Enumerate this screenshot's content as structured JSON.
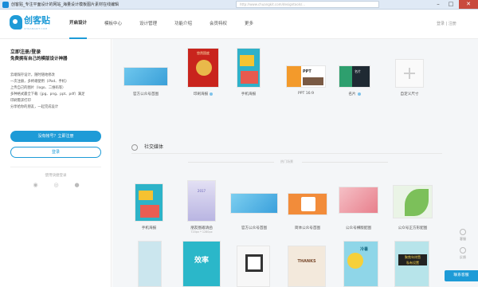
{
  "window": {
    "title": "创客贴_专注平面设计的网站_海量设计模板图片素材在线编辑",
    "url": "http://www.chuangkit.com/designtools/...",
    "controls": {
      "minimize": "–",
      "maximize": "□",
      "close": "✕"
    }
  },
  "brand": {
    "name": "创客贴",
    "tagline": "CHUANGKIT.COM"
  },
  "nav": [
    {
      "label": "开启设计",
      "active": true
    },
    {
      "label": "模板中心",
      "active": false
    },
    {
      "label": "设计管理",
      "active": false
    },
    {
      "label": "功能介绍",
      "active": false
    },
    {
      "label": "会员特权",
      "active": false
    },
    {
      "label": "更多",
      "active": false
    }
  ],
  "user_links": "登录 | 注册",
  "left_panel": {
    "title": "立即注册/登录",
    "subtitle": "免费拥有自己的模版设计神器",
    "features": [
      "云端保存设计，随时随地修改",
      "一次注册，多终端使用（iPad、手机）",
      "上传自己的图片（logo、二维码等）",
      "多种格式最全下载（jpg、png、ppt、pdf）满足",
      "印刷需求打印",
      "分享给你的朋友，一起完成设计"
    ],
    "register_button": "没有帐号？立即注册",
    "login_button": "登录",
    "social_title": "使用快捷登录",
    "social": [
      "weibo-icon",
      "wechat-icon",
      "qq-icon"
    ]
  },
  "templates_top": [
    {
      "label": "官方公众号首图",
      "badge": false
    },
    {
      "label": "印刷海报",
      "badge": true
    },
    {
      "label": "手机海报",
      "badge": false
    },
    {
      "label": "PPT 16:9",
      "badge": false
    },
    {
      "label": "名片",
      "badge": true
    },
    {
      "label": "自定义尺寸",
      "badge": false
    }
  ],
  "hot_tag": "热门场景",
  "section": {
    "title": "社交媒体"
  },
  "templates_social": [
    {
      "label": "手机海报",
      "sub": ""
    },
    {
      "label": "朋友圈邀请函",
      "sub": "720px * 1280px"
    },
    {
      "label": "官方公众号首图",
      "sub": ""
    },
    {
      "label": "简体公众号首图",
      "sub": ""
    },
    {
      "label": "公众号横版配图",
      "sub": ""
    },
    {
      "label": "公众号正方形配图",
      "sub": ""
    }
  ],
  "thumb_text": {
    "poster_top": "悠然国度",
    "ppt": "PPT",
    "card": "名片",
    "event": "2017",
    "promo": "效率",
    "thanks": "THANKS",
    "summer": "冷暑",
    "sales": "聚焦年终暨",
    "sales2": "私有设置"
  },
  "side_tools": [
    "客服",
    "反馈"
  ],
  "service_label": "联系客服",
  "colors": {
    "accent": "#1e9bd7",
    "panel_bg": "#ffffff",
    "main_bg": "#f4f6f8",
    "close_button": "#c94a3e"
  }
}
